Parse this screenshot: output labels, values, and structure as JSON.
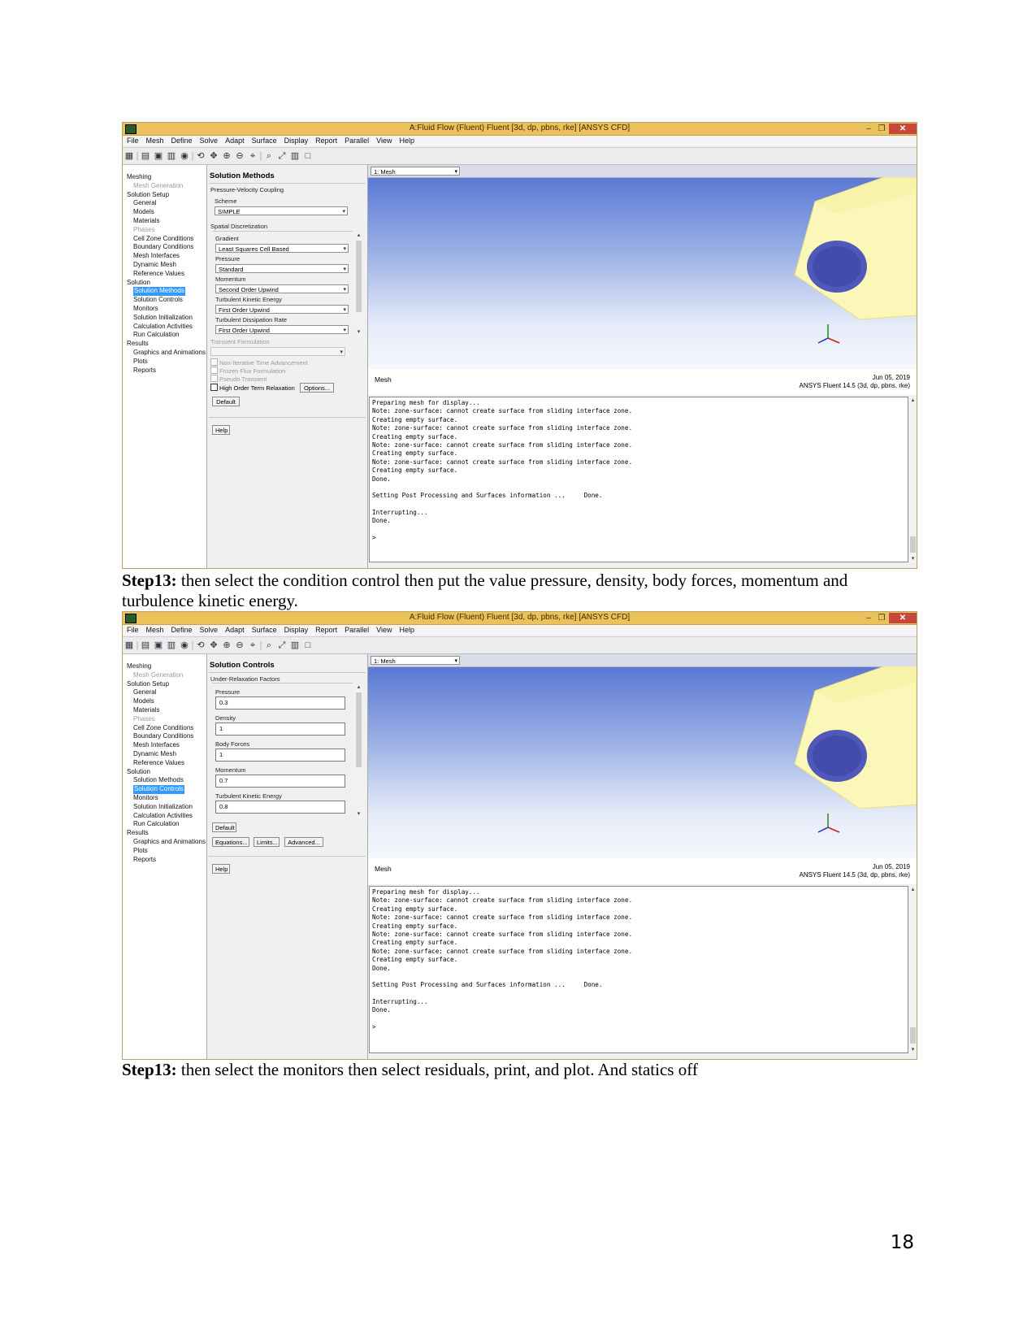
{
  "window": {
    "title": "A:Fluid Flow (Fluent) Fluent [3d, dp, pbns, rke] [ANSYS CFD]",
    "min": "–",
    "max": "❐",
    "close": "✕"
  },
  "menu": [
    "File",
    "Mesh",
    "Define",
    "Solve",
    "Adapt",
    "Surface",
    "Display",
    "Report",
    "Parallel",
    "View",
    "Help"
  ],
  "tree": [
    {
      "label": "Meshing",
      "level": 0,
      "dim": false
    },
    {
      "label": "Mesh Generation",
      "level": 1,
      "dim": true
    },
    {
      "label": "Solution Setup",
      "level": 0,
      "dim": false
    },
    {
      "label": "General",
      "level": 1,
      "dim": false
    },
    {
      "label": "Models",
      "level": 1,
      "dim": false
    },
    {
      "label": "Materials",
      "level": 1,
      "dim": false
    },
    {
      "label": "Phases",
      "level": 1,
      "dim": true
    },
    {
      "label": "Cell Zone Conditions",
      "level": 1,
      "dim": false
    },
    {
      "label": "Boundary Conditions",
      "level": 1,
      "dim": false
    },
    {
      "label": "Mesh Interfaces",
      "level": 1,
      "dim": false
    },
    {
      "label": "Dynamic Mesh",
      "level": 1,
      "dim": false
    },
    {
      "label": "Reference Values",
      "level": 1,
      "dim": false
    },
    {
      "label": "Solution",
      "level": 0,
      "dim": false
    },
    {
      "label": "Solution Methods",
      "level": 1,
      "dim": false
    },
    {
      "label": "Solution Controls",
      "level": 1,
      "dim": false
    },
    {
      "label": "Monitors",
      "level": 1,
      "dim": false
    },
    {
      "label": "Solution Initialization",
      "level": 1,
      "dim": false
    },
    {
      "label": "Calculation Activities",
      "level": 1,
      "dim": false
    },
    {
      "label": "Run Calculation",
      "level": 1,
      "dim": false
    },
    {
      "label": "Results",
      "level": 0,
      "dim": false
    },
    {
      "label": "Graphics and Animations",
      "level": 1,
      "dim": false
    },
    {
      "label": "Plots",
      "level": 1,
      "dim": false
    },
    {
      "label": "Reports",
      "level": 1,
      "dim": false
    }
  ],
  "shot1": {
    "selected_tree_index": 13,
    "panel_title": "Solution Methods",
    "coupling_label": "Pressure-Velocity Coupling",
    "scheme_label": "Scheme",
    "scheme_value": "SIMPLE",
    "spatial_label": "Spatial Discretization",
    "fields": [
      {
        "label": "Gradient",
        "value": "Least Squares Cell Based"
      },
      {
        "label": "Pressure",
        "value": "Standard"
      },
      {
        "label": "Momentum",
        "value": "Second Order Upwind"
      },
      {
        "label": "Turbulent Kinetic Energy",
        "value": "First Order Upwind"
      },
      {
        "label": "Turbulent Dissipation Rate",
        "value": "First Order Upwind"
      }
    ],
    "transient_label": "Transient Formulation",
    "checkboxes": [
      {
        "label": "Non-Iterative Time Advancement",
        "enabled": false
      },
      {
        "label": "Frozen Flux Formulation",
        "enabled": false
      },
      {
        "label": "Pseudo Transient",
        "enabled": false
      },
      {
        "label": "High Order Term Relaxation",
        "enabled": true
      }
    ],
    "options_btn": "Options...",
    "default_btn": "Default",
    "help_btn": "Help"
  },
  "shot2": {
    "selected_tree_index": 14,
    "panel_title": "Solution Controls",
    "urf_label": "Under-Relaxation Factors",
    "fields": [
      {
        "label": "Pressure",
        "value": "0.3"
      },
      {
        "label": "Density",
        "value": "1"
      },
      {
        "label": "Body Forces",
        "value": "1"
      },
      {
        "label": "Momentum",
        "value": "0.7"
      },
      {
        "label": "Turbulent Kinetic Energy",
        "value": "0.8"
      }
    ],
    "default_btn": "Default",
    "equations_btn": "Equations...",
    "limits_btn": "Limits...",
    "advanced_btn": "Advanced...",
    "help_btn": "Help"
  },
  "viewer": {
    "dropdown": "1: Mesh",
    "name": "Mesh",
    "date": "Jun 05, 2019",
    "product": "ANSYS Fluent 14.5 (3d, dp, pbns, rke)"
  },
  "console": [
    "Preparing mesh for display...",
    "Note: zone-surface: cannot create surface from sliding interface zone.",
    "Creating empty surface.",
    "Note: zone-surface: cannot create surface from sliding interface zone.",
    "Creating empty surface.",
    "Note: zone-surface: cannot create surface from sliding interface zone.",
    "Creating empty surface.",
    "Note: zone-surface: cannot create surface from sliding interface zone.",
    "Creating empty surface.",
    "Done.",
    "",
    "Setting Post Processing and Surfaces information ...     Done.",
    "",
    "Interrupting...",
    "Done.",
    "",
    ">"
  ],
  "captions": {
    "c1_step": "Step13:",
    "c1_text": " then select the condition control then put the value pressure, density, body forces, momentum and turbulence kinetic energy.",
    "c2_step": "Step13:",
    "c2_text": " then select the monitors then select residuals, print, and plot. And statics off"
  },
  "page_number": "18"
}
